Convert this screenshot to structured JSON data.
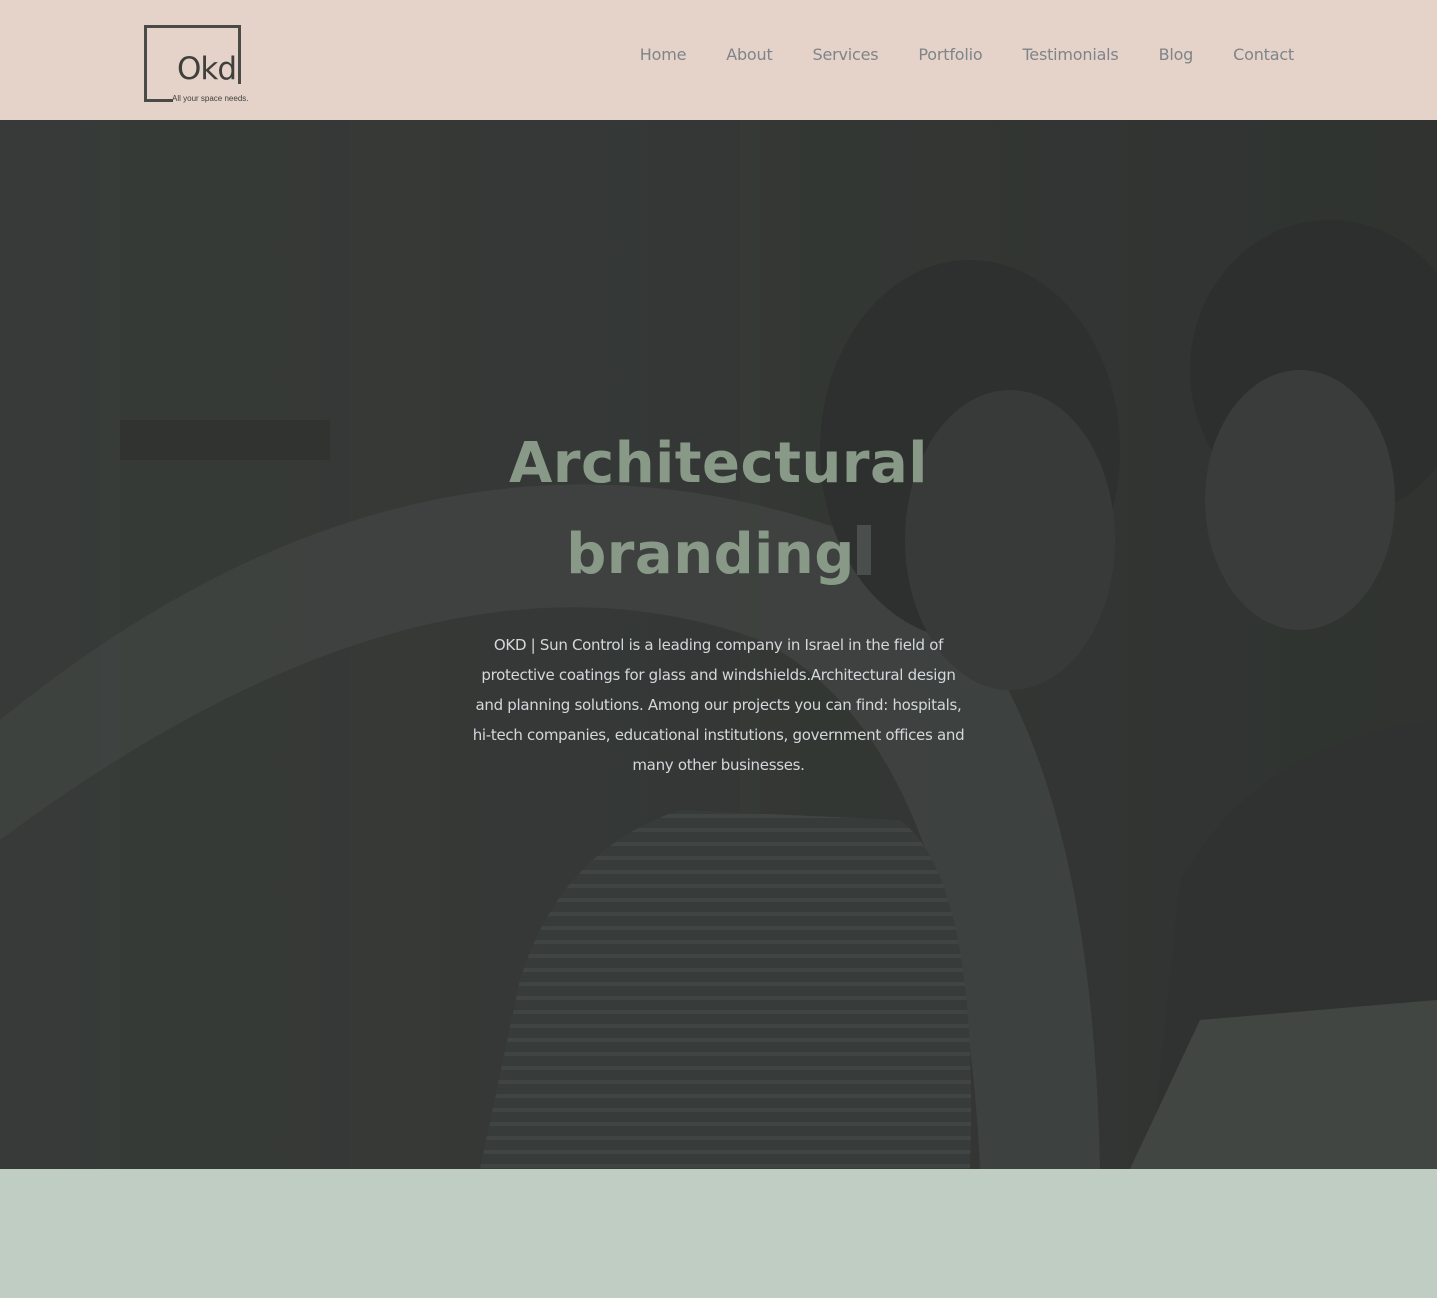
{
  "header": {
    "logo": {
      "wordmark": "Okd",
      "tagline": "All your space needs."
    },
    "nav": [
      {
        "label": "Home"
      },
      {
        "label": "About"
      },
      {
        "label": "Services"
      },
      {
        "label": "Portfolio"
      },
      {
        "label": "Testimonials"
      },
      {
        "label": "Blog"
      },
      {
        "label": "Contact"
      }
    ]
  },
  "hero": {
    "title_line1": "Architectural",
    "title_line2": "branding",
    "description": "OKD | Sun Control is a leading company in Israel in the field of protective coatings for glass and windshields.Architectural design and planning solutions. Among our projects you can find: hospitals, hi-tech companies, educational institutions, government offices and many other businesses."
  },
  "colors": {
    "header_bg": "#e5d3ca",
    "hero_overlay": "#343836",
    "accent_green": "#889a87",
    "footer_bg": "#bfcdc3"
  }
}
